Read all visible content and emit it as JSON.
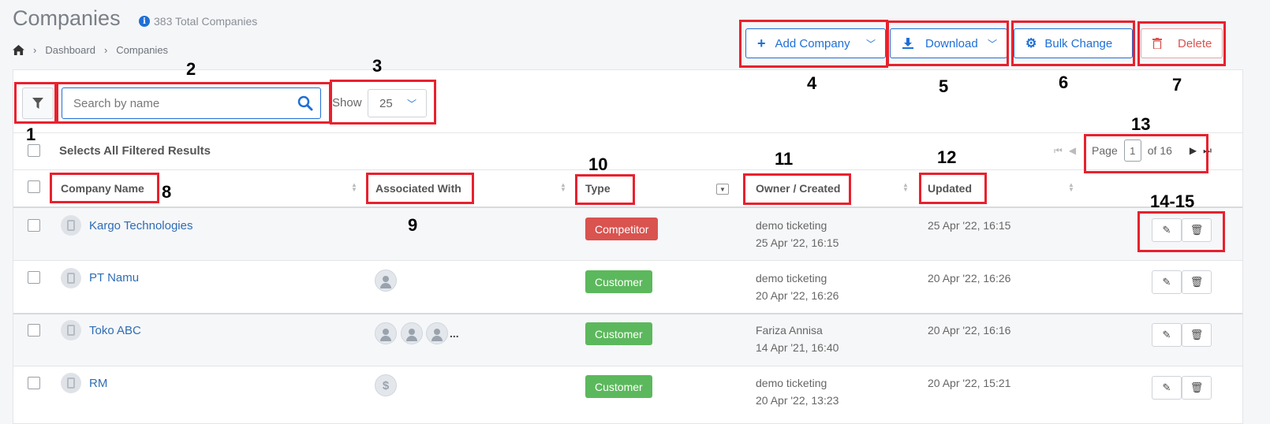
{
  "header": {
    "title": "Companies",
    "total_text": "383 Total Companies",
    "breadcrumb": [
      "Dashboard",
      "Companies"
    ]
  },
  "toolbar": {
    "add_label": "Add Company",
    "download_label": "Download",
    "bulk_label": "Bulk Change",
    "delete_label": "Delete"
  },
  "filters": {
    "search_placeholder": "Search by name",
    "show_label": "Show",
    "show_value": "25"
  },
  "selection": {
    "select_all_label": "Selects All Filtered Results"
  },
  "pagination": {
    "page_label": "Page",
    "current": "1",
    "of_label": "of 16"
  },
  "table": {
    "columns": [
      "Company Name",
      "Associated With",
      "Type",
      "Owner / Created",
      "Updated"
    ],
    "rows": [
      {
        "name": "Kargo Technologies",
        "type": "Competitor",
        "owner": "demo ticketing",
        "created": "25 Apr '22, 16:15",
        "updated": "25 Apr '22, 16:15"
      },
      {
        "name": "PT Namu",
        "type": "Customer",
        "owner": "demo ticketing",
        "created": "20 Apr '22, 16:26",
        "updated": "20 Apr '22, 16:26"
      },
      {
        "name": "Toko ABC",
        "type": "Customer",
        "owner": "Fariza Annisa",
        "created": "14 Apr '21, 16:40",
        "updated": "20 Apr '22, 16:16",
        "more": "..."
      },
      {
        "name": "RM",
        "type": "Customer",
        "owner": "demo ticketing",
        "created": "20 Apr '22, 13:23",
        "updated": "20 Apr '22, 15:21",
        "dollar": "$"
      }
    ]
  },
  "colors": {
    "accent": "#1f6fd6",
    "danger": "#d9534f",
    "success": "#5cb85c",
    "annotation": "#e8212e"
  },
  "annotations": [
    "1",
    "2",
    "3",
    "4",
    "5",
    "6",
    "7",
    "8",
    "9",
    "10",
    "11",
    "12",
    "13",
    "14-15"
  ]
}
